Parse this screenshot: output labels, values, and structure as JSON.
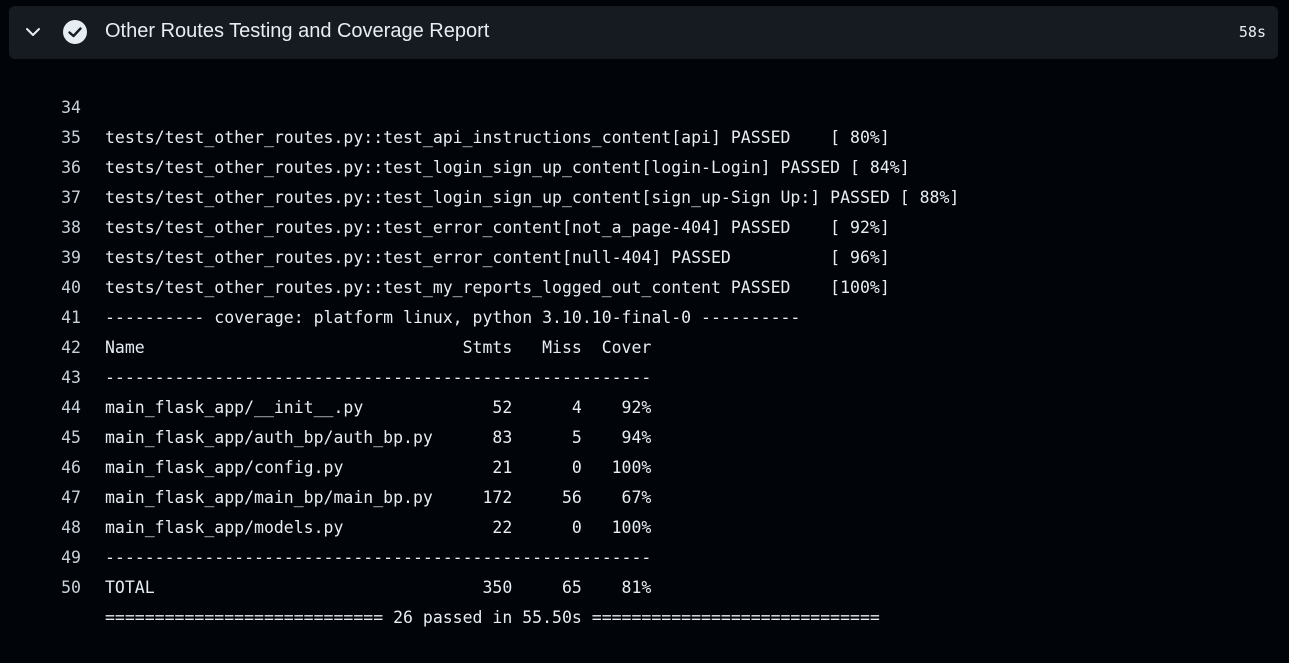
{
  "step": {
    "title": "Other Routes Testing and Coverage Report",
    "duration": "58s",
    "status": "success"
  },
  "colors": {
    "background": "#010409",
    "header_bg": "#161b22",
    "text": "#e6edf3"
  },
  "log_lines": [
    {
      "num": "34",
      "text": "tests/test_other_routes.py::test_api_instructions_content[api] PASSED    [ 80%]"
    },
    {
      "num": "35",
      "text": "tests/test_other_routes.py::test_login_sign_up_content[login-Login] PASSED [ 84%]"
    },
    {
      "num": "36",
      "text": "tests/test_other_routes.py::test_login_sign_up_content[sign_up-Sign Up:] PASSED [ 88%]"
    },
    {
      "num": "37",
      "text": "tests/test_other_routes.py::test_error_content[not_a_page-404] PASSED    [ 92%]"
    },
    {
      "num": "38",
      "text": "tests/test_other_routes.py::test_error_content[null-404] PASSED          [ 96%]"
    },
    {
      "num": "39",
      "text": "tests/test_other_routes.py::test_my_reports_logged_out_content PASSED    [100%]"
    },
    {
      "num": "40",
      "text": "---------- coverage: platform linux, python 3.10.10-final-0 ----------"
    },
    {
      "num": "41",
      "text": "Name                                Stmts   Miss  Cover"
    },
    {
      "num": "42",
      "text": "-------------------------------------------------------"
    },
    {
      "num": "43",
      "text": "main_flask_app/__init__.py             52      4    92%"
    },
    {
      "num": "44",
      "text": "main_flask_app/auth_bp/auth_bp.py      83      5    94%"
    },
    {
      "num": "45",
      "text": "main_flask_app/config.py               21      0   100%"
    },
    {
      "num": "46",
      "text": "main_flask_app/main_bp/main_bp.py     172     56    67%"
    },
    {
      "num": "47",
      "text": "main_flask_app/models.py               22      0   100%"
    },
    {
      "num": "48",
      "text": "-------------------------------------------------------"
    },
    {
      "num": "49",
      "text": "TOTAL                                 350     65    81%"
    },
    {
      "num": "50",
      "text": "============================ 26 passed in 55.50s ============================="
    }
  ]
}
